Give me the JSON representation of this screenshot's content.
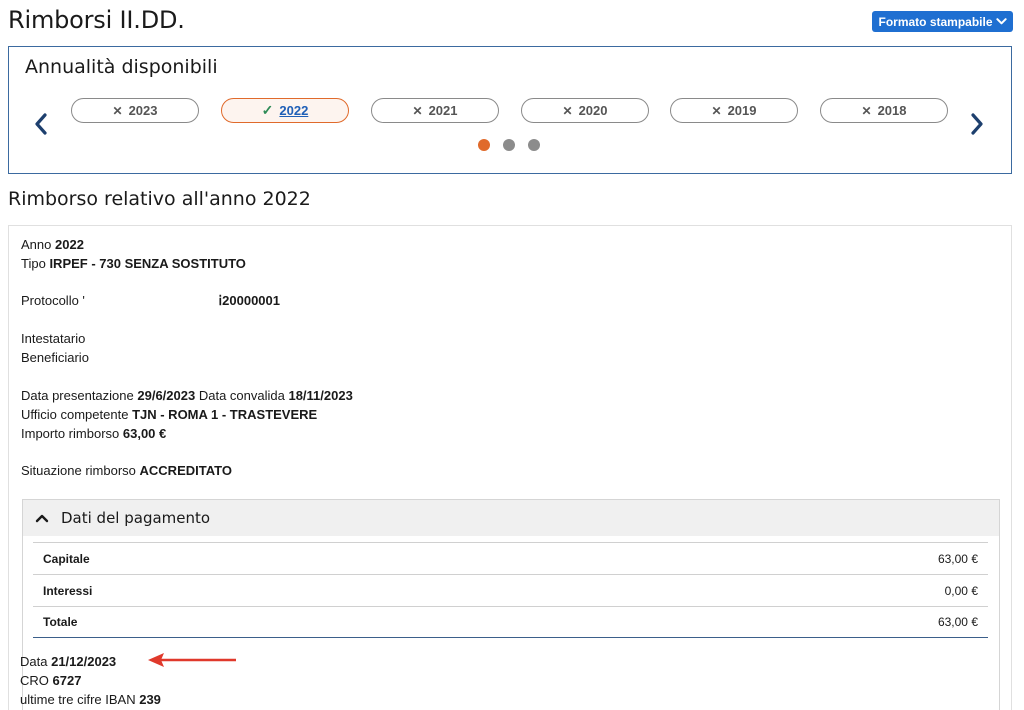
{
  "header": {
    "title": "Rimborsi II.DD.",
    "print_label": "Formato stampabile"
  },
  "years": {
    "title": "Annualità disponibili",
    "items": [
      {
        "label": "2023",
        "active": false
      },
      {
        "label": "2022",
        "active": true
      },
      {
        "label": "2021",
        "active": false
      },
      {
        "label": "2020",
        "active": false
      },
      {
        "label": "2019",
        "active": false
      },
      {
        "label": "2018",
        "active": false
      }
    ],
    "pages": 3,
    "current_page": 1
  },
  "refund": {
    "section_title": "Rimborso relativo all'anno 2022",
    "anno_label": "Anno",
    "anno_value": "2022",
    "tipo_label": "Tipo",
    "tipo_value": "IRPEF - 730 SENZA SOSTITUTO",
    "protocollo_label": "Protocollo '",
    "protocollo_value": "ⅰ20000001",
    "intestatario_label": "Intestatario",
    "beneficiario_label": "Beneficiario",
    "data_presentazione_label": "Data presentazione",
    "data_presentazione_value": "29/6/2023",
    "data_convalida_label": "Data convalida",
    "data_convalida_value": "18/11/2023",
    "ufficio_label": "Ufficio competente",
    "ufficio_value": "TJN - ROMA 1 - TRASTEVERE",
    "importo_label": "Importo rimborso",
    "importo_value": "63,00 €",
    "situazione_label": "Situazione rimborso",
    "situazione_value": "ACCREDITATO"
  },
  "payment": {
    "title": "Dati del pagamento",
    "rows": [
      {
        "label": "Capitale",
        "value": "63,00 €"
      },
      {
        "label": "Interessi",
        "value": "0,00 €"
      },
      {
        "label": "Totale",
        "value": "63,00 €"
      }
    ],
    "data_label": "Data",
    "data_value": "21/12/2023",
    "cro_label": "CRO",
    "cro_value": "6727",
    "iban_label": "ultime tre cifre IBAN",
    "iban_value": "239"
  },
  "colors": {
    "accent_blue": "#1f6fd1",
    "active_orange": "#e06a2b",
    "annotation_red": "#e0392b"
  }
}
